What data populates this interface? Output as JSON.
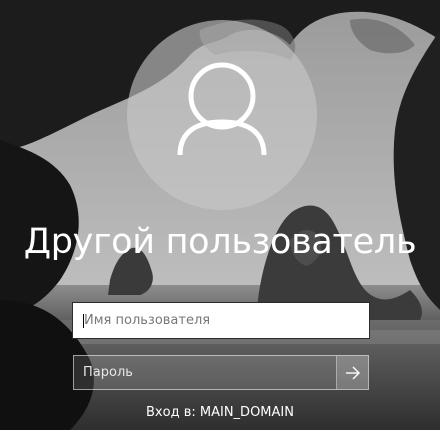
{
  "user_tile": {
    "display_name": "Другой пользователь",
    "icon": "user-silhouette-icon"
  },
  "username_field": {
    "value": "",
    "placeholder": "Имя пользователя"
  },
  "password_field": {
    "value": "",
    "placeholder": "Пароль"
  },
  "submit": {
    "icon": "arrow-right-icon"
  },
  "sign_in_to": {
    "label": "Вход в:",
    "domain": "MAIN_DOMAIN"
  },
  "colors": {
    "text": "#ffffff",
    "avatar_bg": "#c8c8c8",
    "field_bg": "#ffffff"
  }
}
